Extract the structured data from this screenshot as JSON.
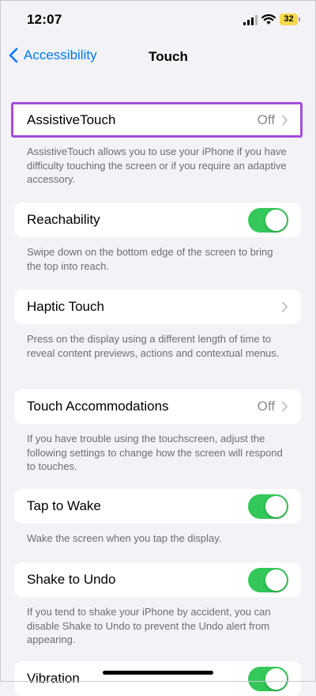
{
  "status_bar": {
    "time": "12:07",
    "battery": "32",
    "battery_color": "#f7d94c"
  },
  "nav": {
    "back_label": "Accessibility",
    "title": "Touch"
  },
  "accent_color": "#007aff",
  "toggle_on_color": "#34c759",
  "highlight_color": "#a24ddc",
  "settings": [
    {
      "label": "AssistiveTouch",
      "value": "Off",
      "control": "chevron",
      "footer": "AssistiveTouch allows you to use your iPhone if you have difficulty touching the screen or if you require an adaptive accessory."
    },
    {
      "label": "Reachability",
      "control": "toggle",
      "on": true,
      "footer": "Swipe down on the bottom edge of the screen to bring the top into reach."
    },
    {
      "label": "Haptic Touch",
      "control": "chevron",
      "footer": "Press on the display using a different length of time to reveal content previews, actions and contextual menus."
    },
    {
      "label": "Touch Accommodations",
      "value": "Off",
      "control": "chevron",
      "footer": "If you have trouble using the touchscreen, adjust the following settings to change how the screen will respond to touches."
    },
    {
      "label": "Tap to Wake",
      "control": "toggle",
      "on": true,
      "footer": "Wake the screen when you tap the display."
    },
    {
      "label": "Shake to Undo",
      "control": "toggle",
      "on": true,
      "footer": "If you tend to shake your iPhone by accident, you can disable Shake to Undo to prevent the Undo alert from appearing."
    },
    {
      "label": "Vibration",
      "control": "toggle",
      "on": true
    }
  ]
}
